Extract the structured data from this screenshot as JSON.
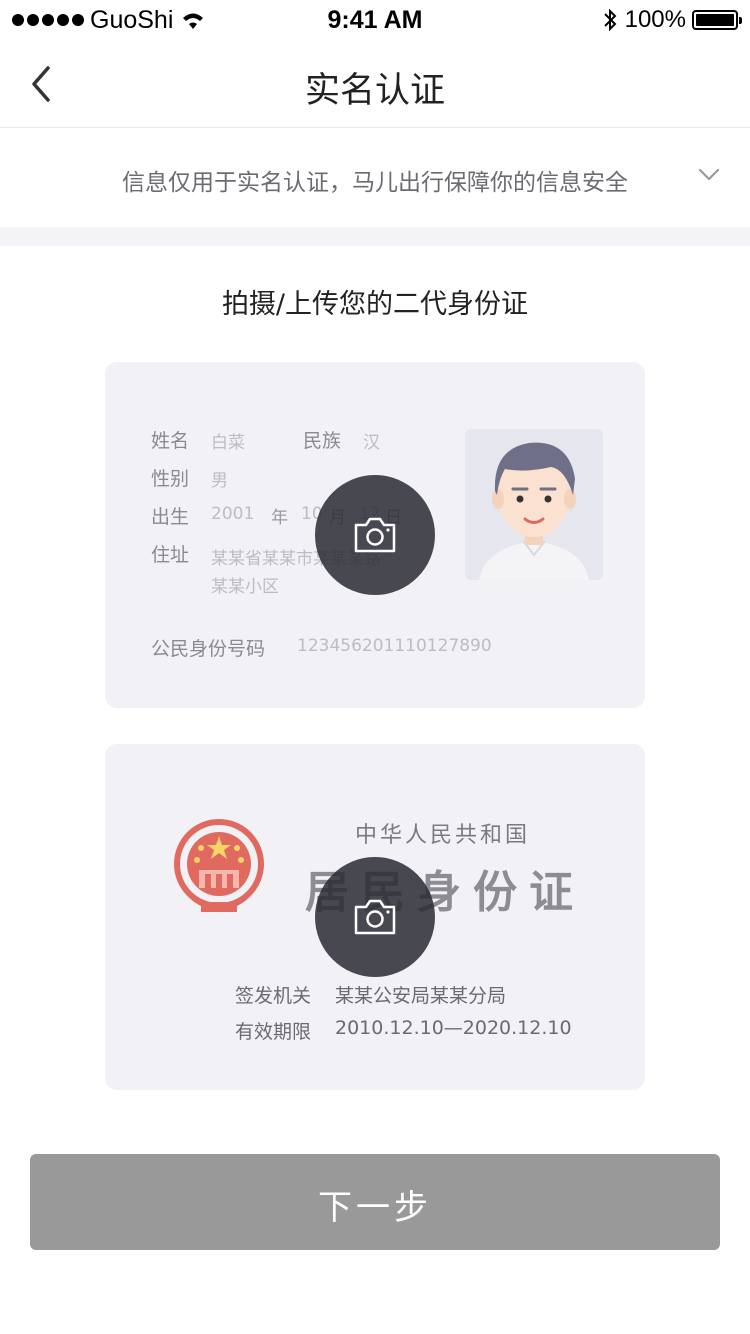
{
  "status_bar": {
    "carrier": "GuoShi",
    "time": "9:41 AM",
    "battery": "100%",
    "icons": [
      "signal-dots-icon",
      "wifi-icon",
      "bluetooth-icon",
      "battery-icon"
    ]
  },
  "nav": {
    "title": "实名认证",
    "back_icon": "chevron-left-icon"
  },
  "notice": {
    "text": "信息仅用于实名认证，马儿出行保障你的信息安全",
    "icon": "chevron-down-icon"
  },
  "section_title": "拍摄/上传您的二代身份证",
  "front_card": {
    "name_label": "姓名",
    "name_value": "白菜",
    "ethnicity_label": "民族",
    "ethnicity_value": "汉",
    "gender_label": "性别",
    "gender_value": "男",
    "birth_label": "出生",
    "birth_year": "2001",
    "birth_year_unit": "年",
    "birth_month": "10",
    "birth_month_unit": "月",
    "birth_day": "12",
    "birth_day_unit": "日",
    "address_label": "住址",
    "address_line1": "某某省某某市某某某路",
    "address_line2": "某某小区",
    "id_label": "公民身份号码",
    "id_value": "123456201110127890",
    "camera_icon": "camera-icon"
  },
  "back_card": {
    "country": "中华人民共和国",
    "title": "居民身份证",
    "authority_label": "签发机关",
    "authority_value": "某某公安局某某分局",
    "validity_label": "有效期限",
    "validity_value": "2010.12.10—2020.12.10",
    "camera_icon": "camera-icon",
    "emblem_icon": "national-emblem-icon"
  },
  "next_button": {
    "label": "下一步"
  },
  "colors": {
    "card_bg": "#f1f1f6",
    "camera_overlay": "#2a2a32",
    "button_disabled": "#999999",
    "emblem_red": "#e06a5f"
  }
}
